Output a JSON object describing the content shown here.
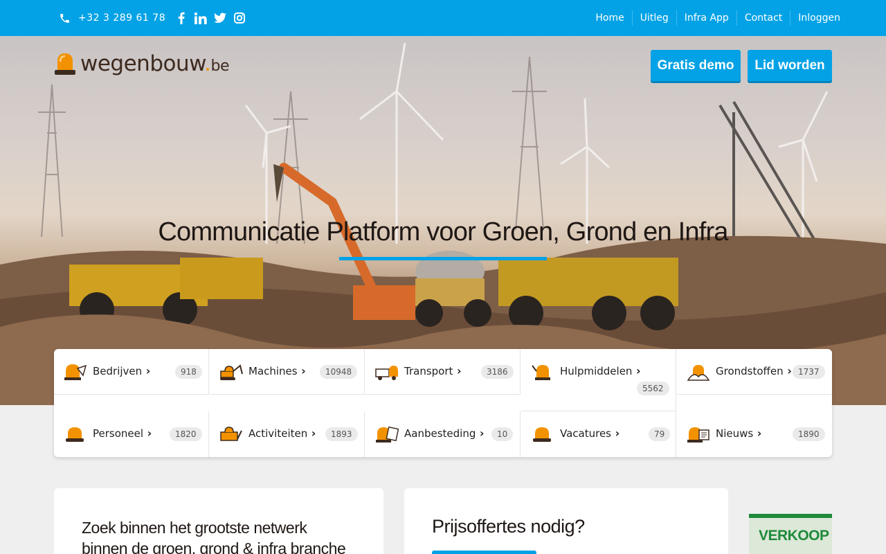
{
  "topbar": {
    "phone": "+32 3 289 61 78",
    "socials": [
      "facebook-icon",
      "linkedin-icon",
      "twitter-icon",
      "instagram-icon"
    ],
    "nav": [
      "Home",
      "Uitleg",
      "Infra App",
      "Contact",
      "Inloggen"
    ]
  },
  "logo": {
    "name": "wegenbouw",
    "dot": ".",
    "tld": "be"
  },
  "header_buttons": {
    "demo": "Gratis demo",
    "join": "Lid worden"
  },
  "hero": {
    "title": "Communicatie Platform voor Groen, Grond en Infra"
  },
  "categories": [
    {
      "label": "Bedrijven",
      "count": "918",
      "icon": "company-icon"
    },
    {
      "label": "Machines",
      "count": "10948",
      "icon": "excavator-icon"
    },
    {
      "label": "Transport",
      "count": "3186",
      "icon": "truck-icon"
    },
    {
      "label": "Hulpmiddelen",
      "count": "5562",
      "icon": "tools-icon"
    },
    {
      "label": "Grondstoffen",
      "count": "1737",
      "icon": "materials-icon"
    },
    {
      "label": "Personeel",
      "count": "1820",
      "icon": "worker-icon"
    },
    {
      "label": "Activiteiten",
      "count": "1893",
      "icon": "activities-icon"
    },
    {
      "label": "Aanbesteding",
      "count": "10",
      "icon": "tender-icon"
    },
    {
      "label": "Vacatures",
      "count": "79",
      "icon": "vacancy-icon"
    },
    {
      "label": "Nieuws",
      "count": "1890",
      "icon": "news-icon"
    }
  ],
  "cards": {
    "search_line1": "Zoek binnen het grootste netwerk",
    "search_line2": "binnen de groen, grond & infra branche",
    "quotes_title": "Prijsoffertes nodig?"
  },
  "ad": {
    "text": "VERKOOP"
  },
  "colors": {
    "primary": "#03a2e6",
    "accent": "#f39200",
    "brand_dark": "#3d2a1e"
  }
}
